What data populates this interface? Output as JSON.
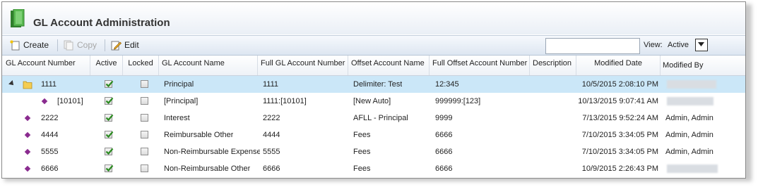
{
  "title": "GL Account Administration",
  "toolbar": {
    "create_label": "Create",
    "copy_label": "Copy",
    "edit_label": "Edit",
    "search_value": "",
    "view_label": "View:",
    "view_value": "Active"
  },
  "columns": [
    "GL Account Number",
    "Active",
    "Locked",
    "GL Account Name",
    "Full GL Account Number",
    "Offset Account Name",
    "Full Offset Account Number",
    "Description",
    "Modified Date",
    "Modified By"
  ],
  "rows": [
    {
      "number": "1111",
      "active": true,
      "locked": false,
      "name": "Principal",
      "full_number": "1111",
      "offset_name": "Delimiter: Test",
      "full_offset": "12:345",
      "description": "",
      "modified_date": "10/5/2015 2:08:10 PM",
      "modified_by": "",
      "selected": true
    },
    {
      "number": "[10101]",
      "active": true,
      "locked": false,
      "name": "[Principal]",
      "full_number": "1111:[10101]",
      "offset_name": "[New Auto]",
      "full_offset": "999999:[123]",
      "description": "",
      "modified_date": "10/13/2015 9:07:41 AM",
      "modified_by": "",
      "selected": false
    },
    {
      "number": "2222",
      "active": true,
      "locked": false,
      "name": "Interest",
      "full_number": "2222",
      "offset_name": "AFLL - Principal",
      "full_offset": "9999",
      "description": "",
      "modified_date": "7/13/2015 9:52:24 AM",
      "modified_by": "Admin, Admin",
      "selected": false
    },
    {
      "number": "4444",
      "active": true,
      "locked": false,
      "name": "Reimbursable Other",
      "full_number": "4444",
      "offset_name": "Fees",
      "full_offset": "6666",
      "description": "",
      "modified_date": "7/10/2015 3:34:05 PM",
      "modified_by": "Admin, Admin",
      "selected": false
    },
    {
      "number": "5555",
      "active": true,
      "locked": false,
      "name": "Non-Reimbursable Expense",
      "full_number": "5555",
      "offset_name": "Fees",
      "full_offset": "6666",
      "description": "",
      "modified_date": "7/10/2015 3:34:05 PM",
      "modified_by": "Admin, Admin",
      "selected": false
    },
    {
      "number": "6666",
      "active": true,
      "locked": false,
      "name": "Non-Reimbursable Other",
      "full_number": "6666",
      "offset_name": "Fees",
      "full_offset": "6666",
      "description": "",
      "modified_date": "10/9/2015 2:26:43 PM",
      "modified_by": "",
      "selected": false
    }
  ],
  "icons": {
    "title": "green-book-icon",
    "create": "create-page-icon",
    "copy": "copy-icon",
    "edit": "edit-pencil-icon",
    "folder": "folder-icon",
    "leaf": "purple-diamond-icon",
    "check": "green-check-icon"
  },
  "colors": {
    "selected_row": "#cbe7f8",
    "leaf_diamond": "#8a2b8f",
    "check_green": "#2a8a1f",
    "title_icon": "#3f9a3a"
  }
}
